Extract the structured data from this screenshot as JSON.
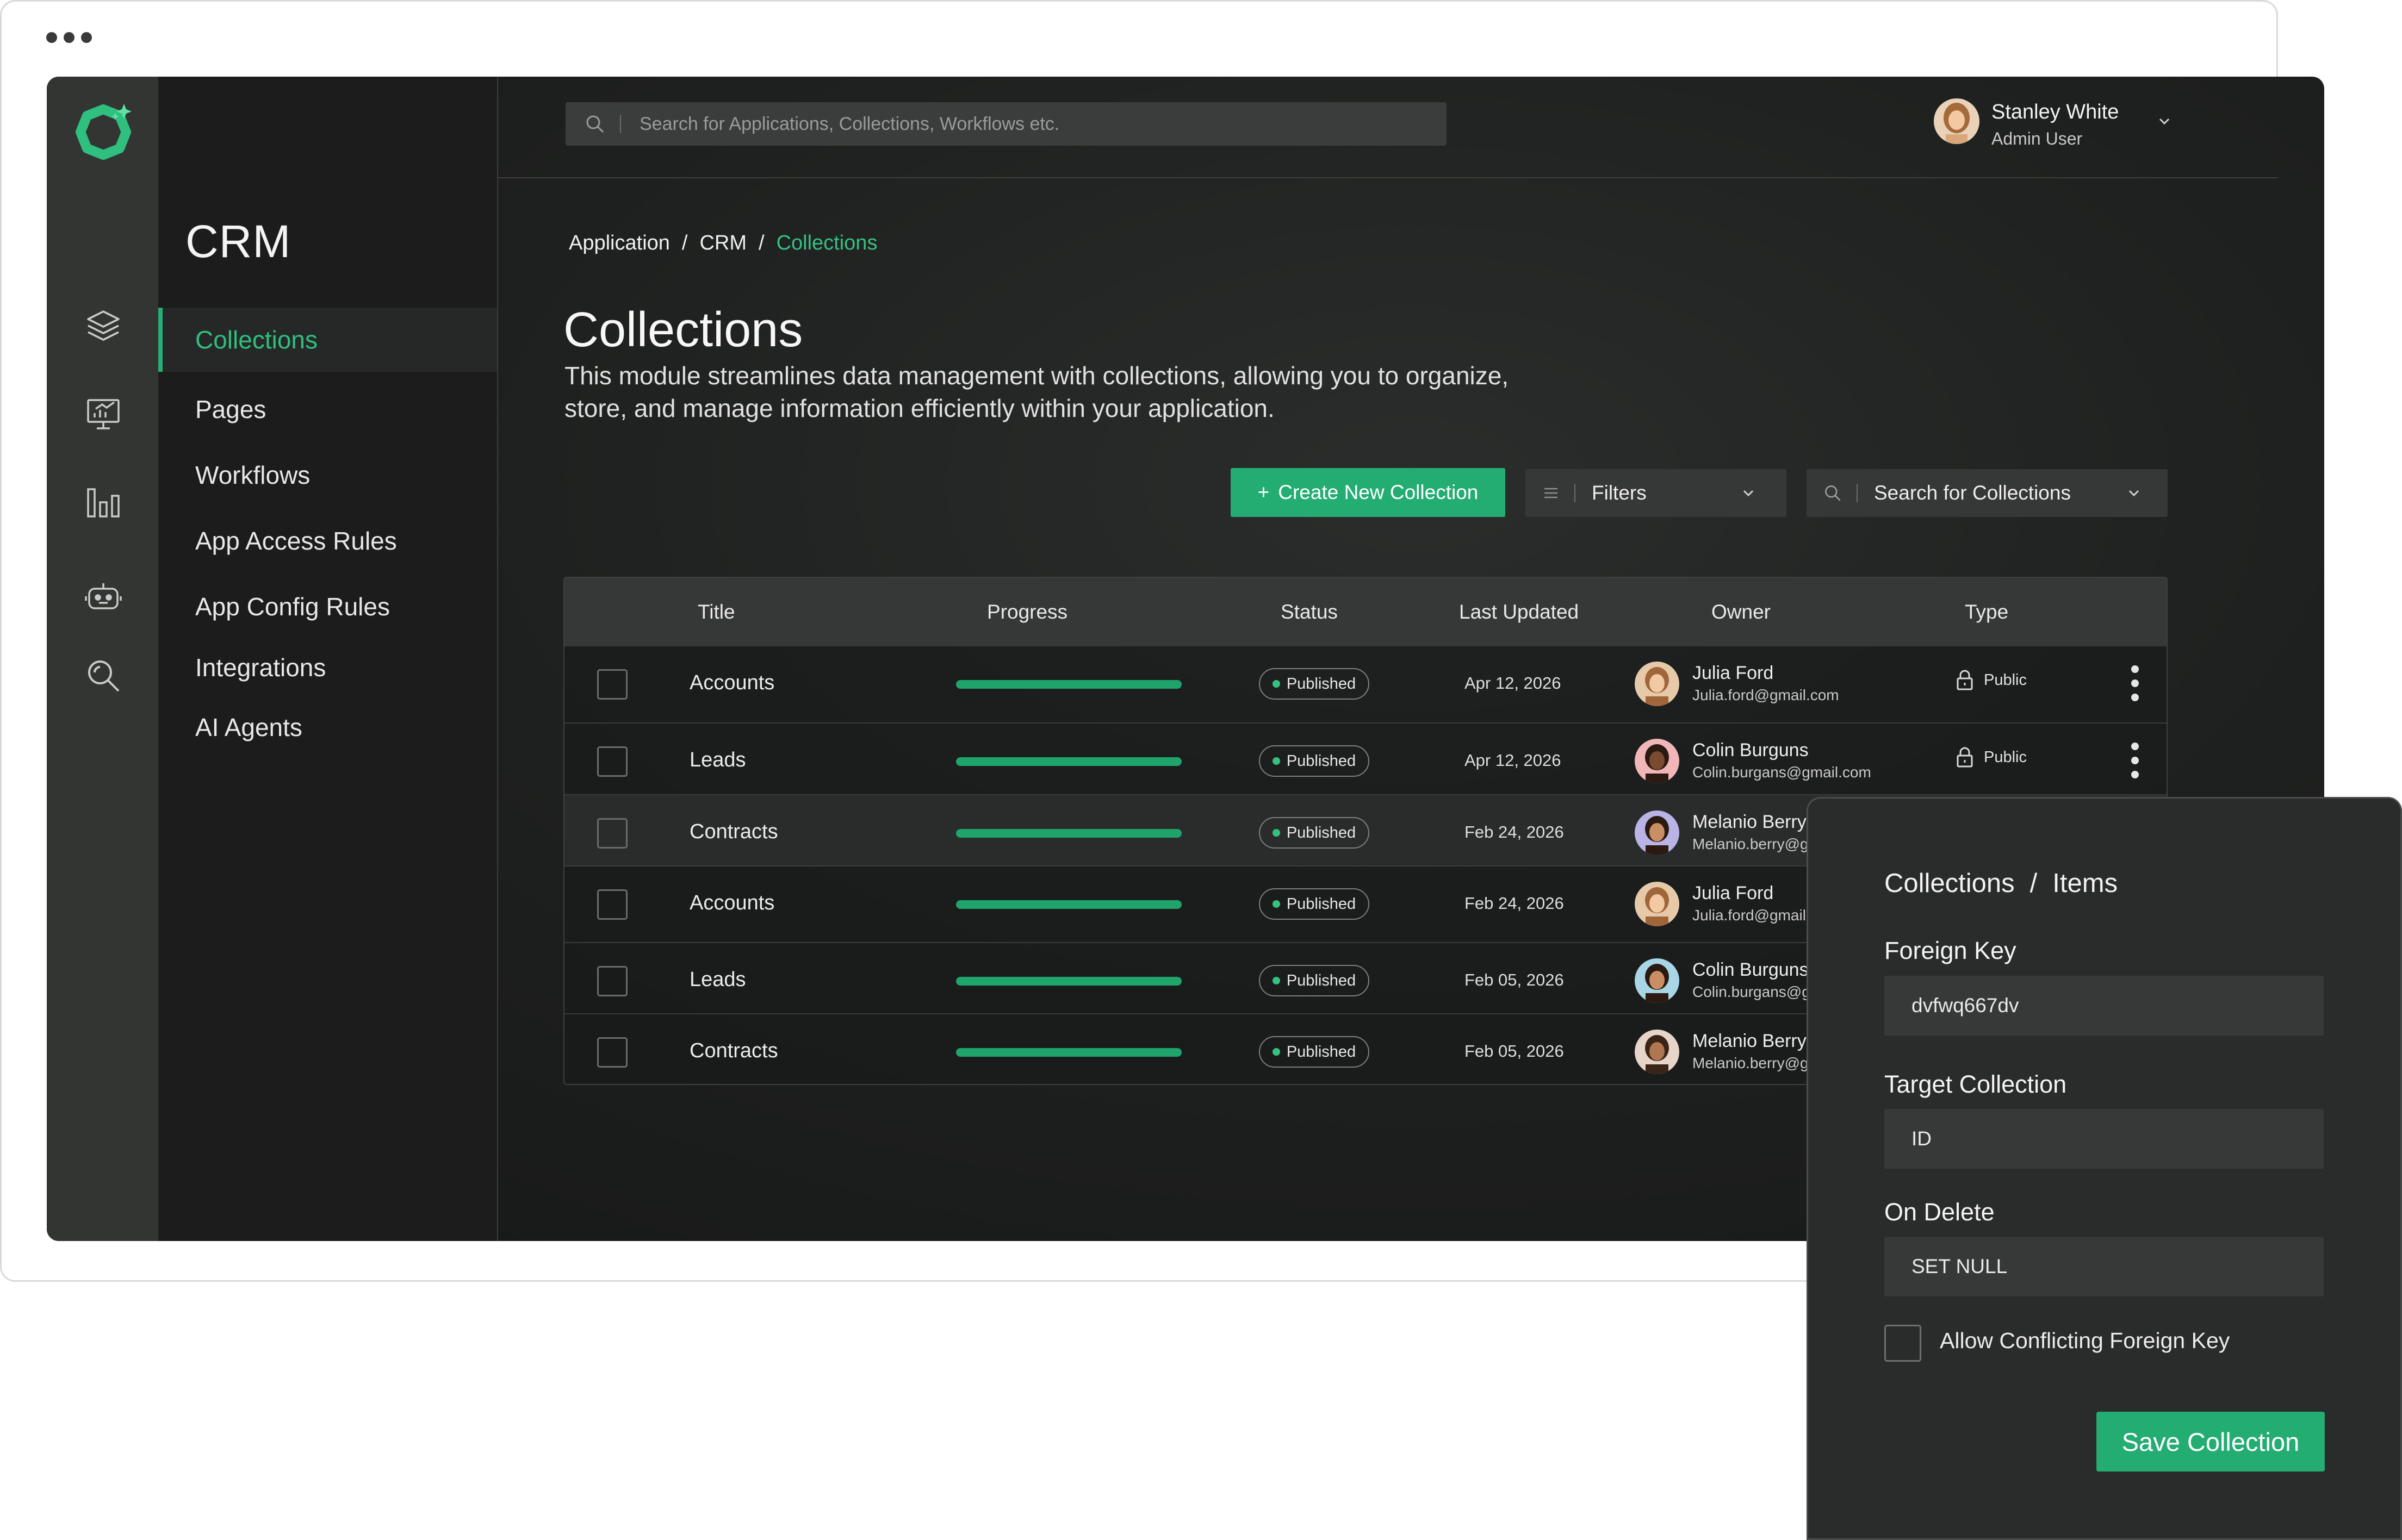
{
  "app": {
    "module_title": "CRM",
    "search_placeholder": "Search for Applications, Collections, Workflows etc.",
    "user": {
      "name": "Stanley White",
      "role": "Admin User"
    }
  },
  "sidebar": {
    "rail_icons": [
      "layers-icon",
      "presentation-chart-icon",
      "bar-chart-icon",
      "robot-icon",
      "search-icon"
    ],
    "items": [
      {
        "label": "Collections",
        "active": true
      },
      {
        "label": "Pages"
      },
      {
        "label": "Workflows"
      },
      {
        "label": "App Access Rules"
      },
      {
        "label": "App Config Rules"
      },
      {
        "label": "Integrations"
      },
      {
        "label": "AI Agents"
      }
    ]
  },
  "breadcrumb": {
    "items": [
      "Application",
      "CRM",
      "Collections"
    ],
    "separator": "/"
  },
  "page": {
    "title": "Collections",
    "description": "This module streamlines data management with collections, allowing you to organize, store, and manage information efficiently within your application."
  },
  "toolbar": {
    "create_label": "Create New Collection",
    "create_icon": "+",
    "filters_label": "Filters",
    "search_label": "Search for Collections"
  },
  "table": {
    "headers": [
      "Title",
      "Progress",
      "Status",
      "Last Updated",
      "Owner",
      "Type"
    ],
    "rows": [
      {
        "title": "Accounts",
        "progress": 1.0,
        "status": "Published",
        "updated": "Apr 12, 2026",
        "owner": "Julia Ford",
        "email": "Julia.ford@gmail.com",
        "type": "Public"
      },
      {
        "title": "Leads",
        "progress": 1.0,
        "status": "Published",
        "updated": "Apr 12, 2026",
        "owner": "Colin Burguns",
        "email": "Colin.burgans@gmail.com",
        "type": "Public"
      },
      {
        "title": "Contracts",
        "progress": 1.0,
        "status": "Published",
        "updated": "Feb 24, 2026",
        "owner": "Melanio Berry",
        "email": "Melanio.berry@gr"
      },
      {
        "title": "Accounts",
        "progress": 1.0,
        "status": "Published",
        "updated": "Feb 24, 2026",
        "owner": "Julia Ford",
        "email": "Julia.ford@gmail.c"
      },
      {
        "title": "Leads",
        "progress": 1.0,
        "status": "Published",
        "updated": "Feb 05,  2026",
        "owner": "Colin Burguns",
        "email": "Colin.burgans@gm"
      },
      {
        "title": "Contracts",
        "progress": 1.0,
        "status": "Published",
        "updated": "Feb 05,  2026",
        "owner": "Melanio Berry",
        "email": "Melanio.berry@gr"
      }
    ]
  },
  "panel": {
    "breadcrumb": [
      "Collections",
      "Items"
    ],
    "separator": "/",
    "foreign_key_label": "Foreign Key",
    "foreign_key_value": "dvfwq667dv",
    "target_label": "Target Collection",
    "target_value": "ID",
    "on_delete_label": "On Delete",
    "on_delete_value": "SET NULL",
    "checkbox_label": "Allow Conflicting Foreign Key",
    "save_label": "Save Collection"
  },
  "colors": {
    "accent": "#24ad73",
    "accent_text": "#2fbf7f",
    "background": "#1b1c1b"
  }
}
